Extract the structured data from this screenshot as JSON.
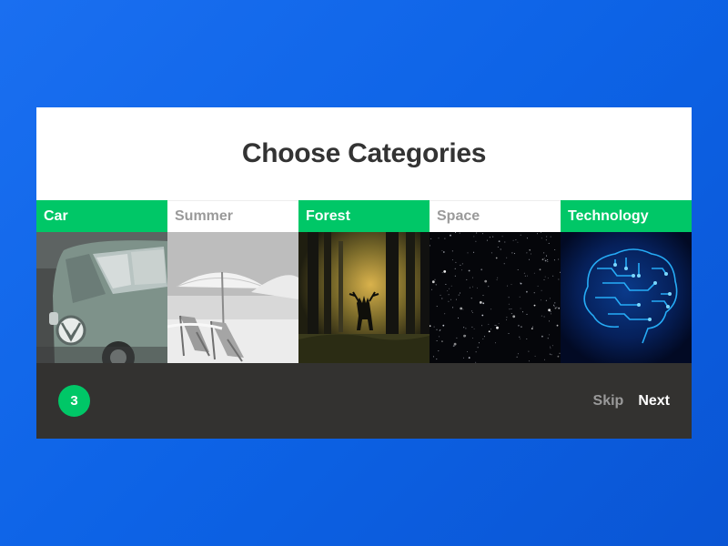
{
  "title": "Choose Categories",
  "categories": [
    {
      "label": "Car",
      "selected": true,
      "icon": "vw-van-image"
    },
    {
      "label": "Summer",
      "selected": false,
      "icon": "beach-chairs-image"
    },
    {
      "label": "Forest",
      "selected": true,
      "icon": "forest-deer-image"
    },
    {
      "label": "Space",
      "selected": false,
      "icon": "starfield-image"
    },
    {
      "label": "Technology",
      "selected": true,
      "icon": "circuit-brain-image"
    }
  ],
  "footer": {
    "selected_count": "3",
    "skip_label": "Skip",
    "next_label": "Next"
  },
  "colors": {
    "accent": "#00c767",
    "background": "#0d63e6",
    "footer": "#333230"
  }
}
